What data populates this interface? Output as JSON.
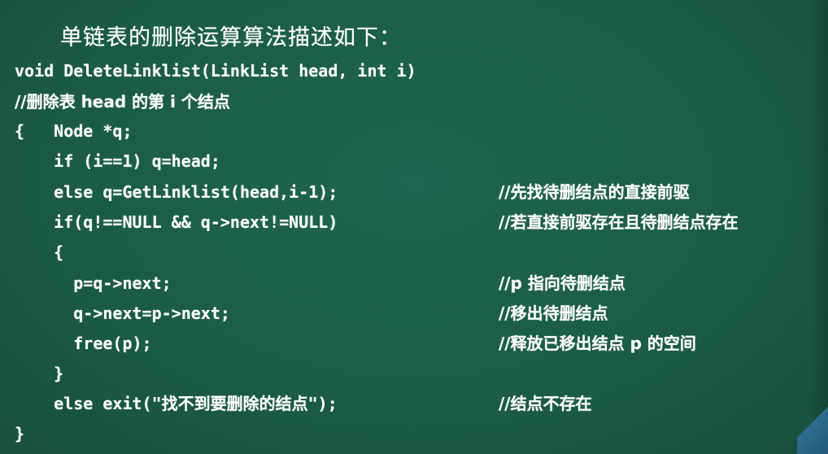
{
  "title": "单链表的删除运算算法描述如下：",
  "code": [
    "void DeleteLinklist(LinkList head, int i)",
    "//删除表 head 的第 i 个结点",
    "{   Node *q;",
    "    if (i==1) q=head;",
    "    else q=GetLinklist(head,i-1);",
    "    if(q!==NULL && q->next!=NULL)",
    "    {",
    "      p=q->next;",
    "      q->next=p->next;",
    "      free(p);",
    "    }",
    "    else exit(\"找不到要删除的结点\");",
    "}"
  ],
  "comments": {
    "else_get": "//先找待删结点的直接前驱",
    "if_check": "//若直接前驱存在且待删结点存在",
    "p_assign": "//p 指向待删结点",
    "q_next": "//移出待删结点",
    "free": "//释放已移出结点 p 的空间",
    "exit": "//结点不存在"
  },
  "colors": {
    "background": "#1b5c48",
    "text": "#ffffff"
  }
}
